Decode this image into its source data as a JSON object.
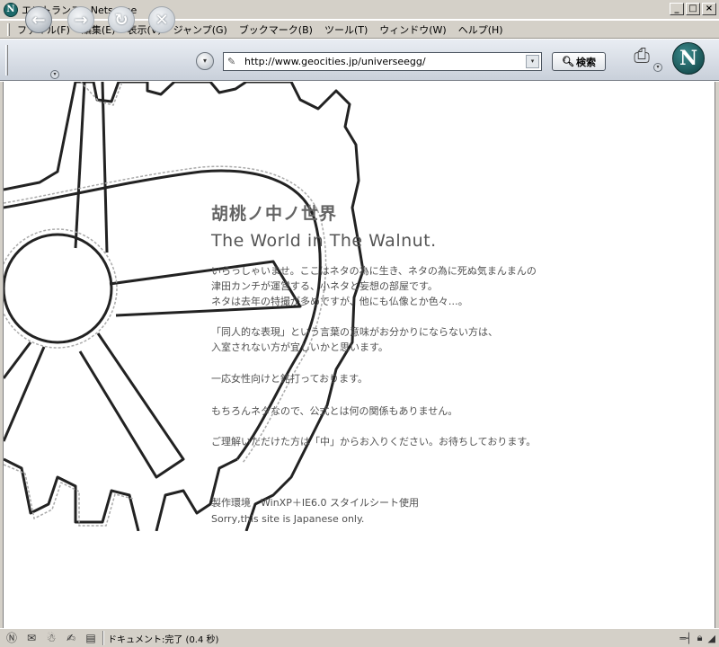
{
  "window": {
    "title": "エントランス - Netscape",
    "app_icon": "N",
    "buttons": [
      "_",
      "□",
      "×"
    ]
  },
  "menubar": {
    "items": [
      "ファイル(F)",
      "編集(E)",
      "表示(V)",
      "ジャンプ(G)",
      "ブックマーク(B)",
      "ツール(T)",
      "ウィンドウ(W)",
      "ヘルプ(H)"
    ]
  },
  "toolbar": {
    "back_icon": "back-arrow-icon",
    "forward_icon": "forward-arrow-icon",
    "reload_icon": "reload-icon",
    "stop_icon": "stop-icon",
    "url": "http://www.geocities.jp/universeegg/",
    "search_label": "検索",
    "logo_letter": "N"
  },
  "page": {
    "title_jp": "胡桃ノ中ノ世界",
    "title_en": "The World in The Walnut.",
    "paragraph1": "いらっしゃいませ。ここはネタの為に生き、ネタの為に死ぬ気まんまんの\n津田カンチが運営する、小ネタと妄想の部屋です。\nネタは去年の特撮が多めですが、他にも仏像とか色々…。",
    "paragraph2": "「同人的な表現」という言葉の意味がお分かりにならない方は、\n入室されない方が宜しいかと思います。",
    "paragraph3": "一応女性向けと銘打っております。",
    "paragraph4": "もちろんネタなので、公式とは何の関係もありません。",
    "paragraph5": "ご理解いただけた方は「中」からお入りください。お待ちしております。",
    "footer1": "製作環境　WinXP＋IE6.0 スタイルシート使用",
    "footer2": "Sorry,this site is Japanese only."
  },
  "statusbar": {
    "text": "ドキュメント:完了 (0.4 秒)"
  },
  "colors": {
    "chrome": "#d4d0c8",
    "text_gray": "#505050"
  }
}
